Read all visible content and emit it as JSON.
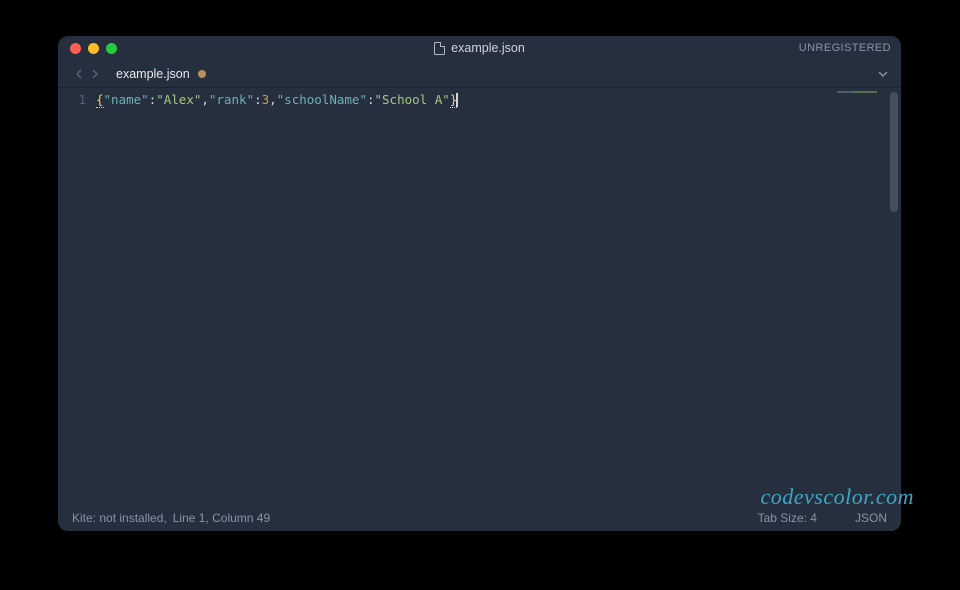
{
  "titlebar": {
    "filename": "example.json",
    "status": "UNREGISTERED"
  },
  "tabbar": {
    "tab_label": "example.json"
  },
  "editor": {
    "line_number": "1",
    "content": {
      "key1": "\"name\"",
      "val1": "\"Alex\"",
      "key2": "\"rank\"",
      "val2": "3",
      "key3": "\"schoolName\"",
      "val3": "\"School A\"",
      "brace_open": "{",
      "brace_close": "}",
      "colon": ":",
      "comma": ","
    }
  },
  "statusbar": {
    "kite": "Kite: not installed,",
    "position": "Line 1, Column 49",
    "tab_size": "Tab Size: 4",
    "syntax": "JSON"
  },
  "watermark": "codevscolor.com"
}
